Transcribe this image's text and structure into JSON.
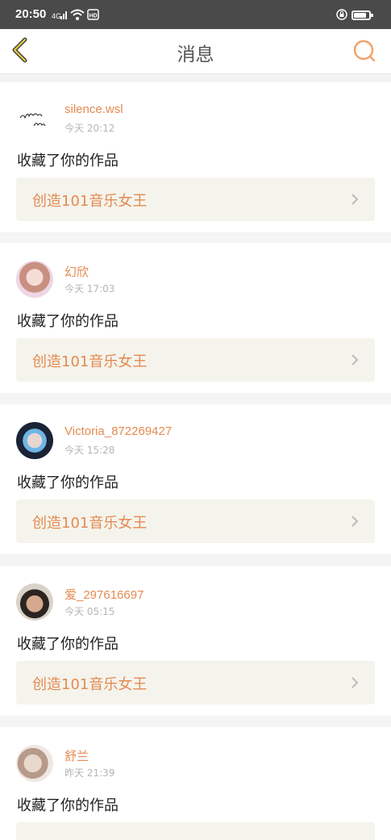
{
  "status_bar": {
    "time": "20:50"
  },
  "header": {
    "title": "消息",
    "back_icon": "chevron-left-icon",
    "search_icon": "search-icon"
  },
  "colors": {
    "accent": "#e58a51",
    "card_bg": "#f4f4ec",
    "status_bar": "#4a4a4a"
  },
  "messages": [
    {
      "user": "silence.wsl",
      "time": "今天 20:12",
      "action": "收藏了你的作品",
      "work_title": "创造101音乐女王"
    },
    {
      "user": "幻欣",
      "time": "今天 17:03",
      "action": "收藏了你的作品",
      "work_title": "创造101音乐女王"
    },
    {
      "user": "Victoria_872269427",
      "time": "今天 15:28",
      "action": "收藏了你的作品",
      "work_title": "创造101音乐女王"
    },
    {
      "user": "爱_297616697",
      "time": "今天 05:15",
      "action": "收藏了你的作品",
      "work_title": "创造101音乐女王"
    },
    {
      "user": "舒兰",
      "time": "昨天 21:39",
      "action": "收藏了你的作品",
      "work_title": ""
    }
  ]
}
